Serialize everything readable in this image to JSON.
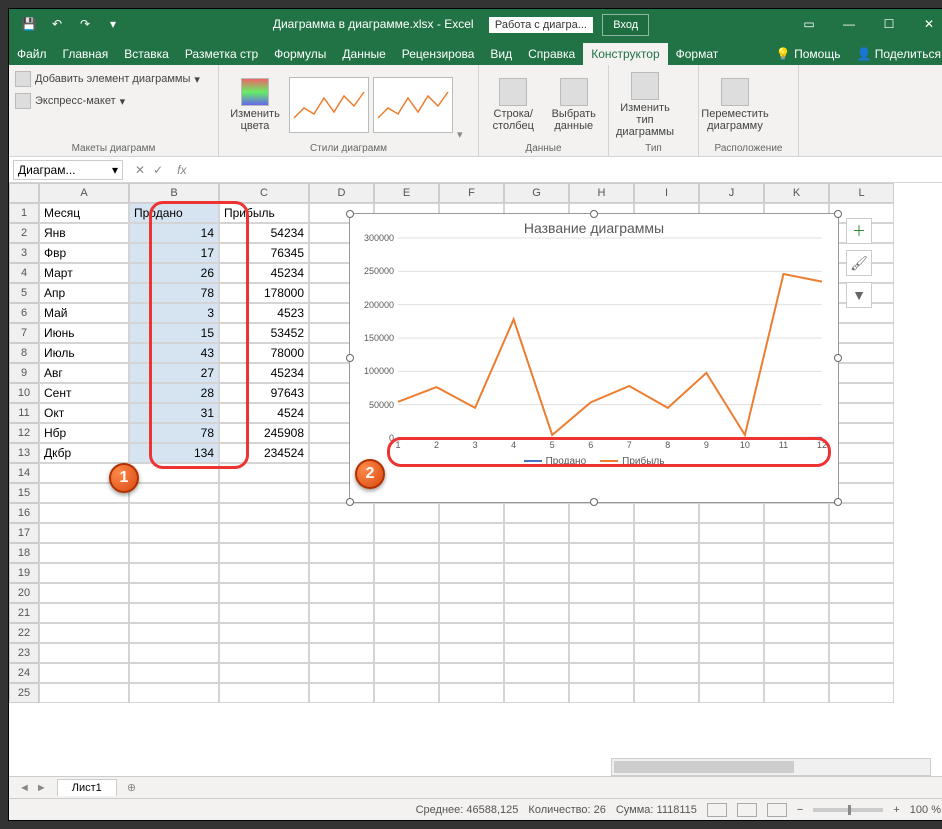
{
  "title": {
    "filename": "Диаграмма в диаграмме.xlsx",
    "app": "Excel",
    "context": "Работа с диагра...",
    "login": "Вход"
  },
  "tabs": {
    "file": "Файл",
    "home": "Главная",
    "insert": "Вставка",
    "layout": "Разметка стр",
    "formulas": "Формулы",
    "data": "Данные",
    "review": "Рецензирова",
    "view": "Вид",
    "help": "Справка",
    "design": "Конструктор",
    "format": "Формат",
    "tell": "Помощь",
    "share": "Поделиться"
  },
  "ribbon": {
    "addElement": "Добавить элемент диаграммы",
    "quickLayout": "Экспресс-макет",
    "layouts": "Макеты диаграмм",
    "changeColors": "Изменить цвета",
    "styles": "Стили диаграмм",
    "switch": "Строка/столбец",
    "selectData": "Выбрать данные",
    "dataGrp": "Данные",
    "changeType": "Изменить тип диаграммы",
    "typeGrp": "Тип",
    "move": "Переместить диаграмму",
    "locGrp": "Расположение"
  },
  "namebox": "Диаграм...",
  "headers": {
    "A": "Месяц",
    "B": "Продано",
    "C": "Прибыль"
  },
  "rows": [
    {
      "m": "Янв",
      "s": 14,
      "p": 54234
    },
    {
      "m": "Фвр",
      "s": 17,
      "p": 76345
    },
    {
      "m": "Март",
      "s": 26,
      "p": 45234
    },
    {
      "m": "Апр",
      "s": 78,
      "p": 178000
    },
    {
      "m": "Май",
      "s": 3,
      "p": 4523
    },
    {
      "m": "Июнь",
      "s": 15,
      "p": 53452
    },
    {
      "m": "Июль",
      "s": 43,
      "p": 78000
    },
    {
      "m": "Авг",
      "s": 27,
      "p": 45234
    },
    {
      "m": "Сент",
      "s": 28,
      "p": 97643
    },
    {
      "m": "Окт",
      "s": 31,
      "p": 4524
    },
    {
      "m": "Нбр",
      "s": 78,
      "p": 245908
    },
    {
      "m": "Дкбр",
      "s": 134,
      "p": 234524
    }
  ],
  "chart_data": {
    "type": "line",
    "title": "Название диаграммы",
    "x": [
      1,
      2,
      3,
      4,
      5,
      6,
      7,
      8,
      9,
      10,
      11,
      12
    ],
    "ylim": [
      0,
      300000
    ],
    "yticks": [
      0,
      50000,
      100000,
      150000,
      200000,
      250000,
      300000
    ],
    "series": [
      {
        "name": "Продано",
        "color": "#4472C4",
        "values": [
          14,
          17,
          26,
          78,
          3,
          15,
          43,
          27,
          28,
          31,
          78,
          134
        ]
      },
      {
        "name": "Прибыль",
        "color": "#ED7D31",
        "values": [
          54234,
          76345,
          45234,
          178000,
          4523,
          53452,
          78000,
          45234,
          97643,
          4524,
          245908,
          234524
        ]
      }
    ]
  },
  "sheetTab": "Лист1",
  "status": {
    "avg_lbl": "Среднее:",
    "avg": "46588,125",
    "cnt_lbl": "Количество:",
    "cnt": "26",
    "sum_lbl": "Сумма:",
    "sum": "1118115",
    "zoom": "100 %"
  },
  "callouts": {
    "one": "1",
    "two": "2"
  },
  "cols": [
    "A",
    "B",
    "C",
    "D",
    "E",
    "F",
    "G",
    "H",
    "I",
    "J",
    "K",
    "L"
  ]
}
